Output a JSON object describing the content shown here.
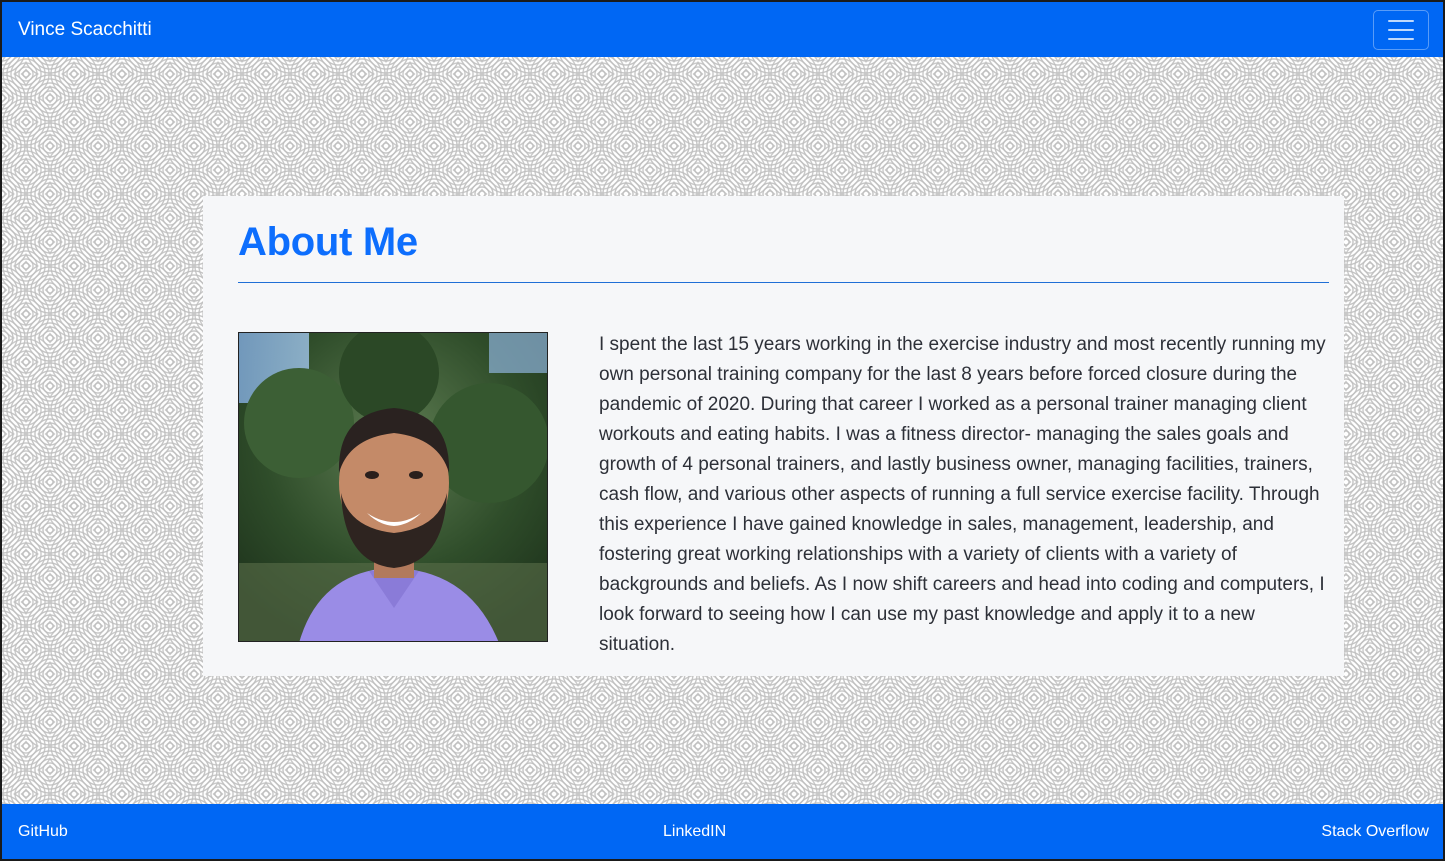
{
  "navbar": {
    "brand": "Vince Scacchitti",
    "toggle_icon": "hamburger-menu-icon"
  },
  "about": {
    "title": "About Me",
    "photo_icon": "profile-photo",
    "bio": "I spent the last 15 years working in the exercise industry and most recently running my own personal training company for the last 8 years before forced closure during the pandemic of 2020. During that career I worked as a personal trainer managing client workouts and eating habits. I was a fitness director- managing the sales goals and growth of 4 personal trainers, and lastly business owner, managing facilities, trainers, cash flow, and various other aspects of running a full service exercise facility. Through this experience I have gained knowledge in sales, management, leadership, and fostering great working relationships with a variety of clients with a variety of backgrounds and beliefs. As I now shift careers and head into coding and computers, I look forward to seeing how I can use my past knowledge and apply it to a new situation."
  },
  "footer": {
    "links": [
      {
        "label": "GitHub"
      },
      {
        "label": "LinkedIN"
      },
      {
        "label": "Stack Overflow"
      }
    ]
  },
  "colors": {
    "primary": "#0067f4",
    "title": "#0d6efd",
    "card_bg": "#f6f7f9"
  }
}
